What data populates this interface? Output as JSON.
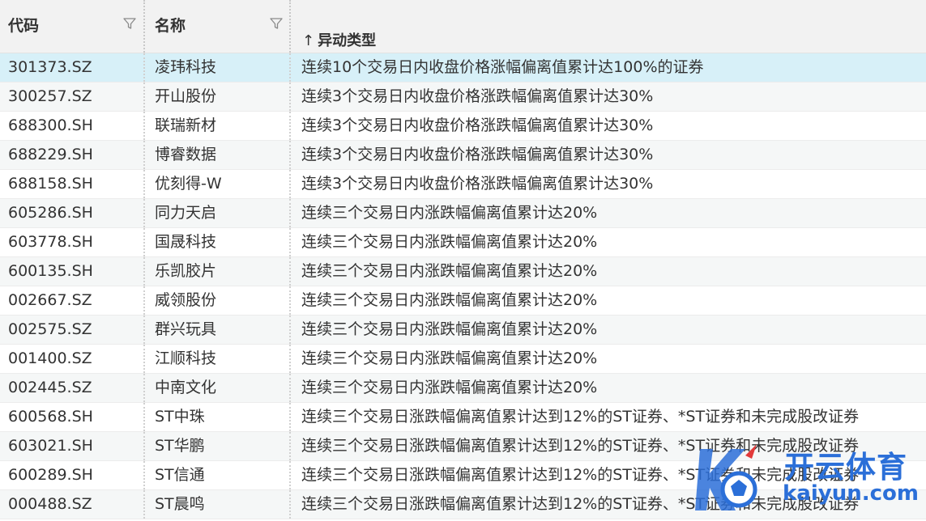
{
  "columns": {
    "code": "代码",
    "name": "名称",
    "type": "异动类型",
    "type_sort_arrow": "↑"
  },
  "rows": [
    {
      "code": "301373.SZ",
      "name": "凌玮科技",
      "type": "连续10个交易日内收盘价格涨幅偏离值累计达100%的证券"
    },
    {
      "code": "300257.SZ",
      "name": "开山股份",
      "type": "连续3个交易日内收盘价格涨跌幅偏离值累计达30%"
    },
    {
      "code": "688300.SH",
      "name": "联瑞新材",
      "type": "连续3个交易日内收盘价格涨跌幅偏离值累计达30%"
    },
    {
      "code": "688229.SH",
      "name": "博睿数据",
      "type": "连续3个交易日内收盘价格涨跌幅偏离值累计达30%"
    },
    {
      "code": "688158.SH",
      "name": "优刻得-W",
      "type": "连续3个交易日内收盘价格涨跌幅偏离值累计达30%"
    },
    {
      "code": "605286.SH",
      "name": "同力天启",
      "type": "连续三个交易日内涨跌幅偏离值累计达20%"
    },
    {
      "code": "603778.SH",
      "name": "国晟科技",
      "type": "连续三个交易日内涨跌幅偏离值累计达20%"
    },
    {
      "code": "600135.SH",
      "name": "乐凯胶片",
      "type": "连续三个交易日内涨跌幅偏离值累计达20%"
    },
    {
      "code": "002667.SZ",
      "name": "威领股份",
      "type": "连续三个交易日内涨跌幅偏离值累计达20%"
    },
    {
      "code": "002575.SZ",
      "name": "群兴玩具",
      "type": "连续三个交易日内涨跌幅偏离值累计达20%"
    },
    {
      "code": "001400.SZ",
      "name": "江顺科技",
      "type": "连续三个交易日内涨跌幅偏离值累计达20%"
    },
    {
      "code": "002445.SZ",
      "name": "中南文化",
      "type": "连续三个交易日内涨跌幅偏离值累计达20%"
    },
    {
      "code": "600568.SH",
      "name": "ST中珠",
      "type": "连续三个交易日涨跌幅偏离值累计达到12%的ST证券、*ST证券和未完成股改证券"
    },
    {
      "code": "603021.SH",
      "name": "ST华鹏",
      "type": "连续三个交易日涨跌幅偏离值累计达到12%的ST证券、*ST证券和未完成股改证券"
    },
    {
      "code": "600289.SH",
      "name": "ST信通",
      "type": "连续三个交易日涨跌幅偏离值累计达到12%的ST证券、*ST证券和未完成股改证券"
    },
    {
      "code": "000488.SZ",
      "name": "ST晨鸣",
      "type": "连续三个交易日涨跌幅偏离值累计达到12%的ST证券、*ST证券和未完成股改证券"
    }
  ],
  "selected_row": 0,
  "watermark": {
    "title": "开云体育",
    "url": "kaiyun.com"
  },
  "colors": {
    "header_bg": "#f2f2f2",
    "selected_row": "#d7f0f8",
    "striped_row": "#f5f7f7",
    "watermark": "#2b6fd8"
  }
}
